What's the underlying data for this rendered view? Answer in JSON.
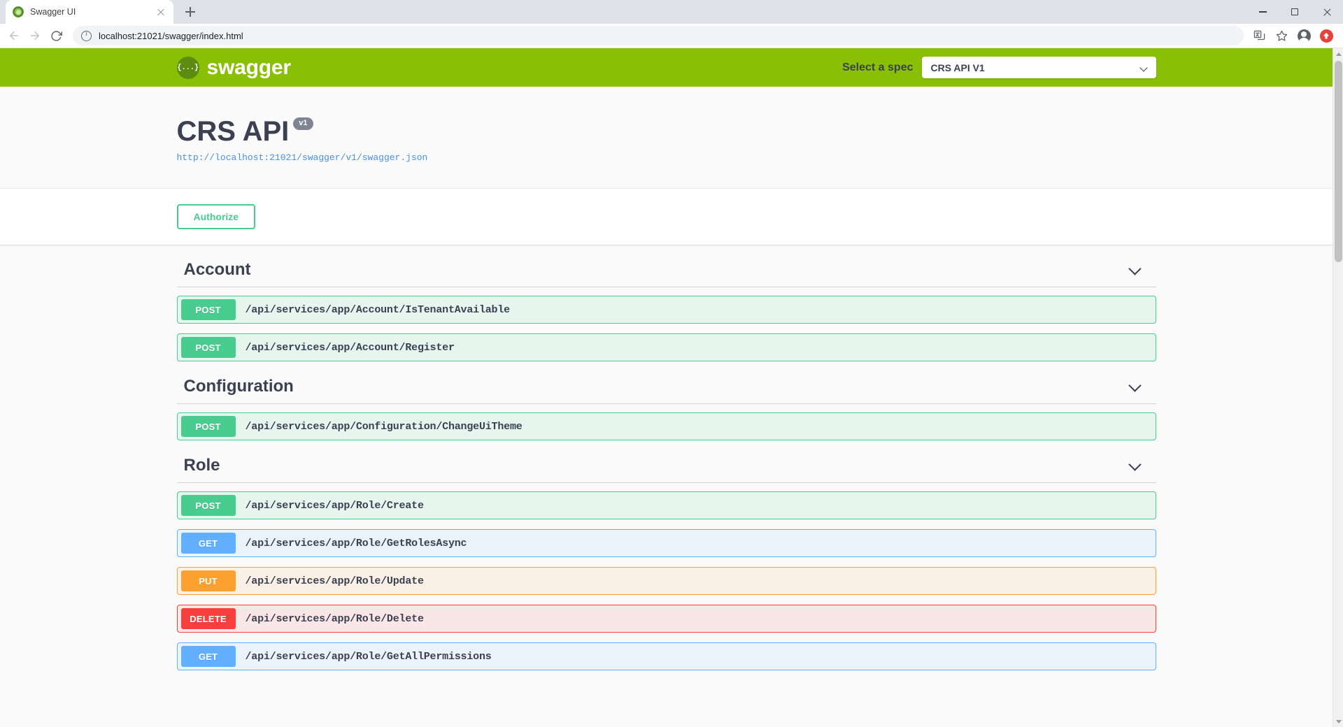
{
  "browser": {
    "tab": {
      "title": "Swagger UI",
      "favicon": "swagger-favicon"
    },
    "new_tab_label": "+",
    "window_controls": {
      "minimize": "minimize",
      "maximize": "maximize",
      "close": "close"
    },
    "nav": {
      "back": "back",
      "forward": "forward",
      "reload": "reload"
    },
    "omnibox": {
      "url_host": "localhost:21021",
      "url_path": "/swagger/index.html",
      "full_url": "localhost:21021/swagger/index.html",
      "site_info_icon": "info-circle-icon"
    },
    "toolbar_right": {
      "translate": "translate-icon",
      "bookmark": "star-icon",
      "profile": "profile-avatar-icon",
      "extension": "extension-icon"
    }
  },
  "topbar": {
    "logo_mark": "{...}",
    "logo_text": "swagger",
    "select_spec_label": "Select a spec",
    "selected_spec": "CRS API V1",
    "spec_options": [
      "CRS API V1"
    ],
    "dropdown_icon": "chevron-down-icon",
    "background_color": "#89bf04"
  },
  "info": {
    "title": "CRS API",
    "version_badge": "v1",
    "definition_url": "http://localhost:21021/swagger/v1/swagger.json"
  },
  "auth": {
    "authorize_label": "Authorize",
    "accent_color": "#49cc90"
  },
  "method_colors": {
    "POST": "#49cc90",
    "GET": "#61affe",
    "PUT": "#fca130",
    "DELETE": "#f93e3e"
  },
  "tags": [
    {
      "name": "Account",
      "expand_icon": "chevron-down-icon",
      "operations": [
        {
          "method": "POST",
          "path": "/api/services/app/Account/IsTenantAvailable"
        },
        {
          "method": "POST",
          "path": "/api/services/app/Account/Register"
        }
      ]
    },
    {
      "name": "Configuration",
      "expand_icon": "chevron-down-icon",
      "operations": [
        {
          "method": "POST",
          "path": "/api/services/app/Configuration/ChangeUiTheme"
        }
      ]
    },
    {
      "name": "Role",
      "expand_icon": "chevron-down-icon",
      "operations": [
        {
          "method": "POST",
          "path": "/api/services/app/Role/Create"
        },
        {
          "method": "GET",
          "path": "/api/services/app/Role/GetRolesAsync"
        },
        {
          "method": "PUT",
          "path": "/api/services/app/Role/Update"
        },
        {
          "method": "DELETE",
          "path": "/api/services/app/Role/Delete"
        },
        {
          "method": "GET",
          "path": "/api/services/app/Role/GetAllPermissions"
        }
      ]
    }
  ],
  "scrollbar": {
    "up_arrow": "scroll-up-arrow",
    "down_arrow": "scroll-down-arrow"
  }
}
